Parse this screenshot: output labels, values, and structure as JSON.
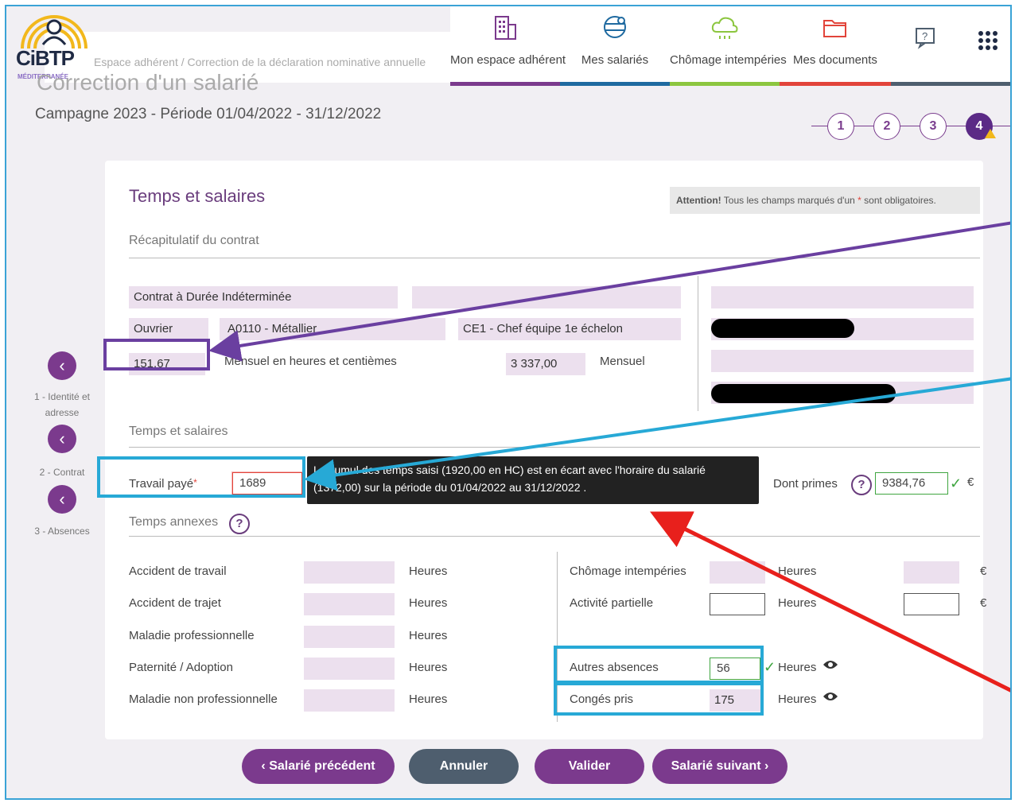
{
  "header": {
    "breadcrumb": "Espace adhérent / Correction de la déclaration nominative annuelle",
    "page_title": "Correction d'un salarié",
    "campaign": "Campagne 2023 - Période 01/04/2022 - 31/12/2022",
    "logo_text": "CiBTP",
    "logo_sub": "MÉDITERRANÉE"
  },
  "topnav": [
    {
      "label": "Mon espace adhérent",
      "icon": "building-icon",
      "color": "#7b3a8d"
    },
    {
      "label": "Mes salariés",
      "icon": "people-icon",
      "color": "#1f6aa0"
    },
    {
      "label": "Chômage intempéries",
      "icon": "cloud-icon",
      "color": "#8cc63f"
    },
    {
      "label": "Mes documents",
      "icon": "folder-icon",
      "color": "#e2443a"
    },
    {
      "label": "",
      "icon": "help-icon",
      "color": "#4e5e6e"
    },
    {
      "label": "",
      "icon": "apps-grid-icon",
      "color": "#4e5e6e"
    }
  ],
  "steps": [
    "1",
    "2",
    "3",
    "4"
  ],
  "sidenav": [
    {
      "label": "1 - Identité et adresse"
    },
    {
      "label": "2 - Contrat"
    },
    {
      "label": "3 - Absences"
    }
  ],
  "card": {
    "title": "Temps et salaires",
    "attention_strong": "Attention!",
    "attention_text": " Tous les champs marqués d'un ",
    "attention_star": "*",
    "attention_end": " sont obligatoires.",
    "recap_title": "Récapitulatif du contrat",
    "contract_type": "Contrat à Durée Indéterminée",
    "category": "Ouvrier",
    "job": "A0110 - Métallier",
    "level": "CE1 - Chef équipe 1e échelon",
    "hours": "151,67",
    "hours_label": "Mensuel en heures et centièmes",
    "salary": "3 337,00",
    "salary_label": "Mensuel",
    "ts_title": "Temps et salaires",
    "travail_label": "Travail payé",
    "travail_value": "1689",
    "tooltip": "Le cumul des temps saisi (1920,00 en HC) est en écart avec l'horaire du salarié (1372,00) sur la période du 01/04/2022 au 31/12/2022 .",
    "primes_label": "Dont primes",
    "primes_value": "9384,76",
    "currency": "€",
    "annexes_title": "Temps annexes",
    "hours_unit": "Heures",
    "left_rows": [
      "Accident de travail",
      "Accident de trajet",
      "Maladie professionnelle",
      "Paternité / Adoption",
      "Maladie non professionnelle"
    ],
    "chomage_label": "Chômage intempéries",
    "activite_label": "Activité partielle",
    "autres_label": "Autres absences",
    "autres_value": "56",
    "conges_label": "Congés pris",
    "conges_value": "175"
  },
  "buttons": {
    "prev": "Salarié précédent",
    "cancel": "Annuler",
    "validate": "Valider",
    "next": "Salarié suivant"
  }
}
